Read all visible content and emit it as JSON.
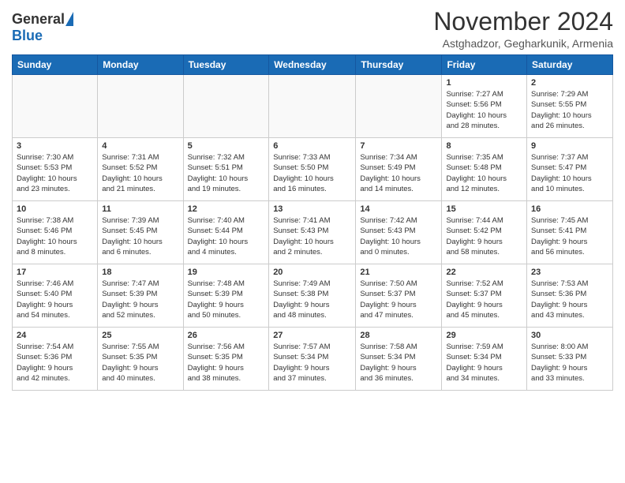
{
  "header": {
    "logo_general": "General",
    "logo_blue": "Blue",
    "month_title": "November 2024",
    "location": "Astghadzor, Gegharkunik, Armenia"
  },
  "weekdays": [
    "Sunday",
    "Monday",
    "Tuesday",
    "Wednesday",
    "Thursday",
    "Friday",
    "Saturday"
  ],
  "weeks": [
    [
      {
        "day": "",
        "info": ""
      },
      {
        "day": "",
        "info": ""
      },
      {
        "day": "",
        "info": ""
      },
      {
        "day": "",
        "info": ""
      },
      {
        "day": "",
        "info": ""
      },
      {
        "day": "1",
        "info": "Sunrise: 7:27 AM\nSunset: 5:56 PM\nDaylight: 10 hours\nand 28 minutes."
      },
      {
        "day": "2",
        "info": "Sunrise: 7:29 AM\nSunset: 5:55 PM\nDaylight: 10 hours\nand 26 minutes."
      }
    ],
    [
      {
        "day": "3",
        "info": "Sunrise: 7:30 AM\nSunset: 5:53 PM\nDaylight: 10 hours\nand 23 minutes."
      },
      {
        "day": "4",
        "info": "Sunrise: 7:31 AM\nSunset: 5:52 PM\nDaylight: 10 hours\nand 21 minutes."
      },
      {
        "day": "5",
        "info": "Sunrise: 7:32 AM\nSunset: 5:51 PM\nDaylight: 10 hours\nand 19 minutes."
      },
      {
        "day": "6",
        "info": "Sunrise: 7:33 AM\nSunset: 5:50 PM\nDaylight: 10 hours\nand 16 minutes."
      },
      {
        "day": "7",
        "info": "Sunrise: 7:34 AM\nSunset: 5:49 PM\nDaylight: 10 hours\nand 14 minutes."
      },
      {
        "day": "8",
        "info": "Sunrise: 7:35 AM\nSunset: 5:48 PM\nDaylight: 10 hours\nand 12 minutes."
      },
      {
        "day": "9",
        "info": "Sunrise: 7:37 AM\nSunset: 5:47 PM\nDaylight: 10 hours\nand 10 minutes."
      }
    ],
    [
      {
        "day": "10",
        "info": "Sunrise: 7:38 AM\nSunset: 5:46 PM\nDaylight: 10 hours\nand 8 minutes."
      },
      {
        "day": "11",
        "info": "Sunrise: 7:39 AM\nSunset: 5:45 PM\nDaylight: 10 hours\nand 6 minutes."
      },
      {
        "day": "12",
        "info": "Sunrise: 7:40 AM\nSunset: 5:44 PM\nDaylight: 10 hours\nand 4 minutes."
      },
      {
        "day": "13",
        "info": "Sunrise: 7:41 AM\nSunset: 5:43 PM\nDaylight: 10 hours\nand 2 minutes."
      },
      {
        "day": "14",
        "info": "Sunrise: 7:42 AM\nSunset: 5:43 PM\nDaylight: 10 hours\nand 0 minutes."
      },
      {
        "day": "15",
        "info": "Sunrise: 7:44 AM\nSunset: 5:42 PM\nDaylight: 9 hours\nand 58 minutes."
      },
      {
        "day": "16",
        "info": "Sunrise: 7:45 AM\nSunset: 5:41 PM\nDaylight: 9 hours\nand 56 minutes."
      }
    ],
    [
      {
        "day": "17",
        "info": "Sunrise: 7:46 AM\nSunset: 5:40 PM\nDaylight: 9 hours\nand 54 minutes."
      },
      {
        "day": "18",
        "info": "Sunrise: 7:47 AM\nSunset: 5:39 PM\nDaylight: 9 hours\nand 52 minutes."
      },
      {
        "day": "19",
        "info": "Sunrise: 7:48 AM\nSunset: 5:39 PM\nDaylight: 9 hours\nand 50 minutes."
      },
      {
        "day": "20",
        "info": "Sunrise: 7:49 AM\nSunset: 5:38 PM\nDaylight: 9 hours\nand 48 minutes."
      },
      {
        "day": "21",
        "info": "Sunrise: 7:50 AM\nSunset: 5:37 PM\nDaylight: 9 hours\nand 47 minutes."
      },
      {
        "day": "22",
        "info": "Sunrise: 7:52 AM\nSunset: 5:37 PM\nDaylight: 9 hours\nand 45 minutes."
      },
      {
        "day": "23",
        "info": "Sunrise: 7:53 AM\nSunset: 5:36 PM\nDaylight: 9 hours\nand 43 minutes."
      }
    ],
    [
      {
        "day": "24",
        "info": "Sunrise: 7:54 AM\nSunset: 5:36 PM\nDaylight: 9 hours\nand 42 minutes."
      },
      {
        "day": "25",
        "info": "Sunrise: 7:55 AM\nSunset: 5:35 PM\nDaylight: 9 hours\nand 40 minutes."
      },
      {
        "day": "26",
        "info": "Sunrise: 7:56 AM\nSunset: 5:35 PM\nDaylight: 9 hours\nand 38 minutes."
      },
      {
        "day": "27",
        "info": "Sunrise: 7:57 AM\nSunset: 5:34 PM\nDaylight: 9 hours\nand 37 minutes."
      },
      {
        "day": "28",
        "info": "Sunrise: 7:58 AM\nSunset: 5:34 PM\nDaylight: 9 hours\nand 36 minutes."
      },
      {
        "day": "29",
        "info": "Sunrise: 7:59 AM\nSunset: 5:34 PM\nDaylight: 9 hours\nand 34 minutes."
      },
      {
        "day": "30",
        "info": "Sunrise: 8:00 AM\nSunset: 5:33 PM\nDaylight: 9 hours\nand 33 minutes."
      }
    ]
  ]
}
